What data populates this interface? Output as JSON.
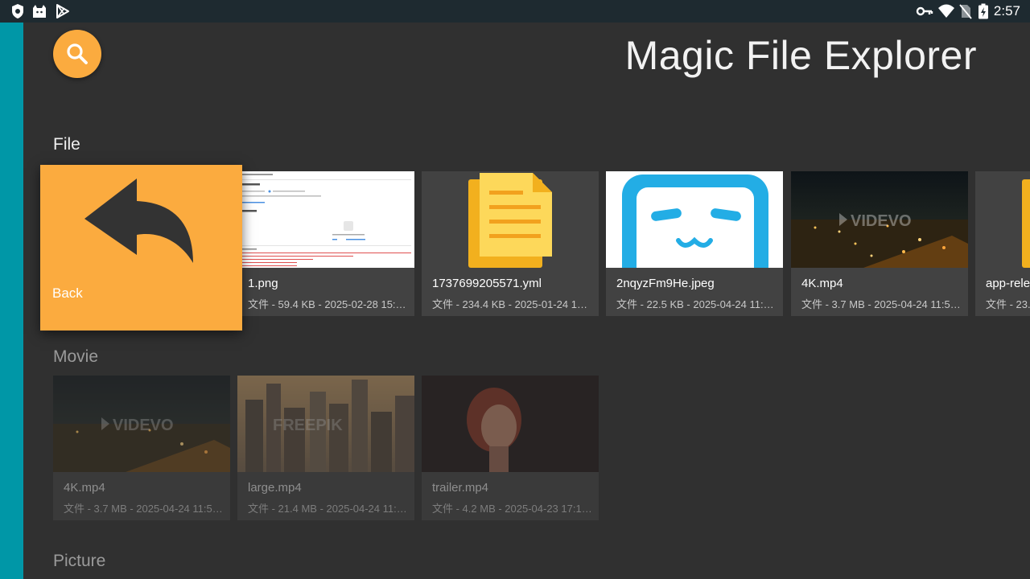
{
  "status_bar": {
    "time": "2:57",
    "left_icons": [
      "shield-icon",
      "cat-icon",
      "play-store-icon"
    ],
    "right_icons": [
      "key-icon",
      "wifi-icon",
      "no-sim-icon",
      "battery-charging-icon"
    ]
  },
  "header": {
    "title": "Magic File Explorer",
    "search_icon": "search-icon"
  },
  "sections": {
    "file": {
      "title": "File",
      "back": {
        "label": "Back",
        "icon": "reply-arrow-icon"
      },
      "items": [
        {
          "name": "1.png",
          "meta": "文件 - 59.4 KB - 2025-02-28 15:04:..."
        },
        {
          "name": "1737699205571.yml",
          "meta": "文件 - 234.4 KB - 2025-01-24 14:1..."
        },
        {
          "name": "2nqyzFm9He.jpeg",
          "meta": "文件 - 22.5 KB - 2025-04-24 11:06:..."
        },
        {
          "name": "4K.mp4",
          "meta": "文件 - 3.7 MB - 2025-04-24 11:57:...",
          "watermark": "VIDEVO"
        },
        {
          "name": "app-relea",
          "meta": "文件 - 23."
        }
      ]
    },
    "movie": {
      "title": "Movie",
      "items": [
        {
          "name": "4K.mp4",
          "meta": "文件 - 3.7 MB - 2025-04-24 11:57:...",
          "watermark": "VIDEVO"
        },
        {
          "name": "large.mp4",
          "meta": "文件 - 21.4 MB - 2025-04-24 11:56...",
          "watermark": "FREEPIK"
        },
        {
          "name": "trailer.mp4",
          "meta": "文件 - 4.2 MB - 2025-04-23 17:12:..."
        }
      ]
    },
    "picture": {
      "title": "Picture"
    }
  },
  "colors": {
    "accent": "#fbab3f",
    "background": "#303030",
    "card": "#424242",
    "teal": "#0097a7",
    "bilibili_blue": "#23ade5"
  }
}
